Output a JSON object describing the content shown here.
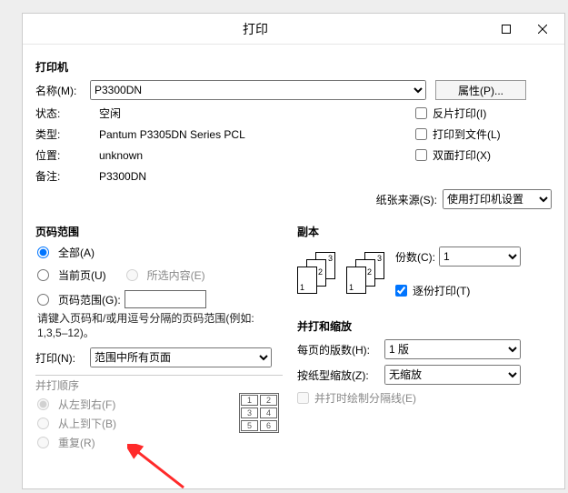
{
  "dialog": {
    "title": "打印"
  },
  "printer": {
    "section": "打印机",
    "name_label": "名称(M):",
    "name_value": "P3300DN",
    "properties_label": "属性(P)...",
    "status_label": "状态:",
    "status_value": "空闲",
    "type_label": "类型:",
    "type_value": "Pantum P3305DN Series PCL",
    "location_label": "位置:",
    "location_value": "unknown",
    "comment_label": "备注:",
    "comment_value": "P3300DN",
    "reverse_label": "反片打印(I)",
    "tofile_label": "打印到文件(L)",
    "duplex_label": "双面打印(X)"
  },
  "paper": {
    "source_label": "纸张来源(S):",
    "source_value": "使用打印机设置"
  },
  "range": {
    "section": "页码范围",
    "all_label": "全部(A)",
    "current_label": "当前页(U)",
    "selection_label": "所选内容(E)",
    "range_label": "页码范围(G):",
    "hint": "请键入页码和/或用逗号分隔的页码范围(例如: 1,3,5–12)。",
    "print_label": "打印(N):",
    "print_value": "范围中所有页面"
  },
  "order": {
    "section": "并打顺序",
    "ltr_label": "从左到右(F)",
    "ttb_label": "从上到下(B)",
    "repeat_label": "重复(R)",
    "cells": [
      "1",
      "2",
      "3",
      "4",
      "5",
      "6"
    ]
  },
  "copies": {
    "section": "副本",
    "count_label": "份数(C):",
    "count_value": "1",
    "collate_label": "逐份打印(T)"
  },
  "scale": {
    "section": "并打和缩放",
    "pages_label": "每页的版数(H):",
    "pages_value": "1 版",
    "zoom_label": "按纸型缩放(Z):",
    "zoom_value": "无缩放",
    "drawline_label": "并打时绘制分隔线(E)"
  }
}
